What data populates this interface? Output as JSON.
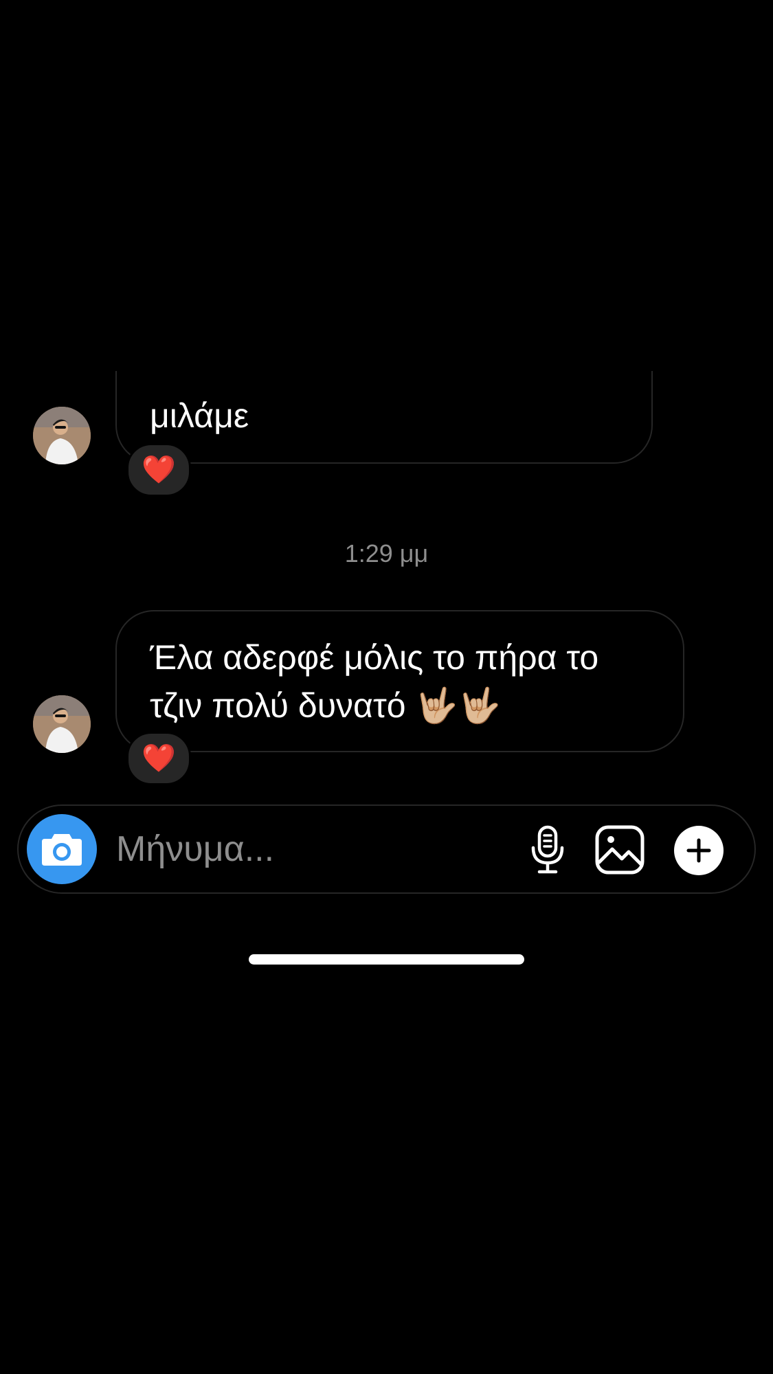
{
  "messages": [
    {
      "text": "μιλάμε",
      "reaction": "❤️"
    },
    {
      "line1": "Έλα αδερφέ μόλις το πήρα το",
      "line2": "τζιν πολύ δυνατό 🤟🏼🤟🏼",
      "reaction": "❤️"
    }
  ],
  "timestamp": "1:29 μμ",
  "composer": {
    "placeholder": "Μήνυμα...",
    "camera_icon": "camera-icon",
    "mic_icon": "microphone-icon",
    "gallery_icon": "gallery-icon",
    "add_icon": "plus-circle-icon"
  },
  "colors": {
    "background": "#000000",
    "bubble_border": "#262626",
    "reaction_bg": "#262626",
    "timestamp": "#8e8e8e",
    "camera_button": "#3797f0"
  }
}
